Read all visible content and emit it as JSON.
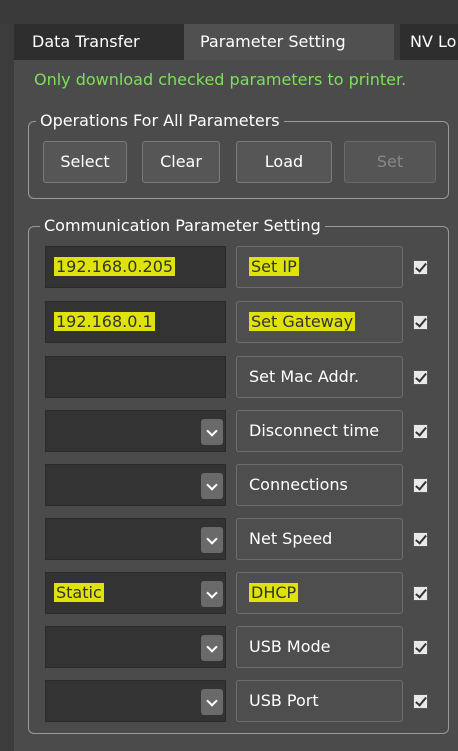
{
  "tabs": [
    "Data Transfer",
    "Parameter Setting",
    "NV Lo"
  ],
  "notice": "Only download checked parameters to printer.",
  "operations": {
    "title": "Operations For All Parameters",
    "select": "Select",
    "clear": "Clear",
    "load": "Load",
    "set": "Set"
  },
  "communication": {
    "title": "Communication Parameter Setting",
    "rows": [
      {
        "value": "192.168.0.205",
        "button": "Set IP",
        "checked": true
      },
      {
        "value": "192.168.0.1",
        "button": "Set Gateway",
        "checked": true
      },
      {
        "value": "",
        "button": "Set Mac Addr.",
        "checked": true
      },
      {
        "value": "",
        "button": "Disconnect time",
        "checked": true
      },
      {
        "value": "",
        "button": "Connections",
        "checked": true
      },
      {
        "value": "",
        "button": "Net Speed",
        "checked": true
      },
      {
        "value": "Static",
        "button": "DHCP",
        "checked": true
      },
      {
        "value": "",
        "button": "USB Mode",
        "checked": true
      },
      {
        "value": "",
        "button": "USB Port",
        "checked": true
      }
    ]
  },
  "colors": {
    "notice_green": "#7ee05a",
    "highlight_yellow": "#dfe30a",
    "panel_bg": "#4b4b4b"
  }
}
